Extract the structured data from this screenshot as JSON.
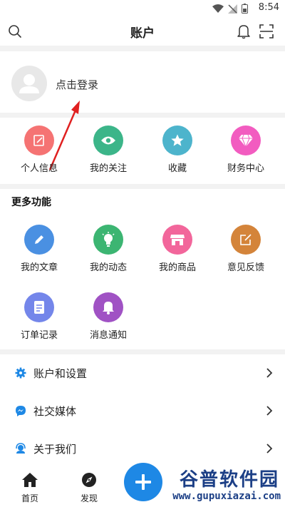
{
  "status_bar": {
    "time": "8:54"
  },
  "header": {
    "title": "账户"
  },
  "login": {
    "label": "点击登录"
  },
  "quick_items": [
    {
      "label": "个人信息",
      "color": "#f57373",
      "icon": "edit-icon"
    },
    {
      "label": "我的关注",
      "color": "#3cb589",
      "icon": "eye-icon"
    },
    {
      "label": "收藏",
      "color": "#4db4cc",
      "icon": "star-icon"
    },
    {
      "label": "财务中心",
      "color": "#f25cc0",
      "icon": "diamond-icon"
    }
  ],
  "more": {
    "title": "更多功能",
    "items": [
      {
        "label": "我的文章",
        "color": "#4a90e2",
        "icon": "pencil-icon"
      },
      {
        "label": "我的动态",
        "color": "#3cb572",
        "icon": "lightbulb-icon"
      },
      {
        "label": "我的商品",
        "color": "#f2669b",
        "icon": "shop-icon"
      },
      {
        "label": "意见反馈",
        "color": "#d4843a",
        "icon": "feedback-icon"
      },
      {
        "label": "订单记录",
        "color": "#7486ea",
        "icon": "document-icon"
      },
      {
        "label": "消息通知",
        "color": "#a052c4",
        "icon": "bell-icon"
      }
    ]
  },
  "menu": [
    {
      "label": "账户和设置",
      "icon": "gear-icon"
    },
    {
      "label": "社交媒体",
      "icon": "messenger-icon"
    },
    {
      "label": "关于我们",
      "icon": "support-icon"
    }
  ],
  "bottom_nav": [
    {
      "label": "首页",
      "icon": "home-icon"
    },
    {
      "label": "发现",
      "icon": "compass-icon"
    }
  ],
  "watermark": {
    "line1": "谷普软件园",
    "line2": "www.gupuxiazai.com"
  },
  "colors": {
    "accent": "#1e88e5",
    "menu_icon": "#1e88e5",
    "divider": "#f2f2f2"
  }
}
